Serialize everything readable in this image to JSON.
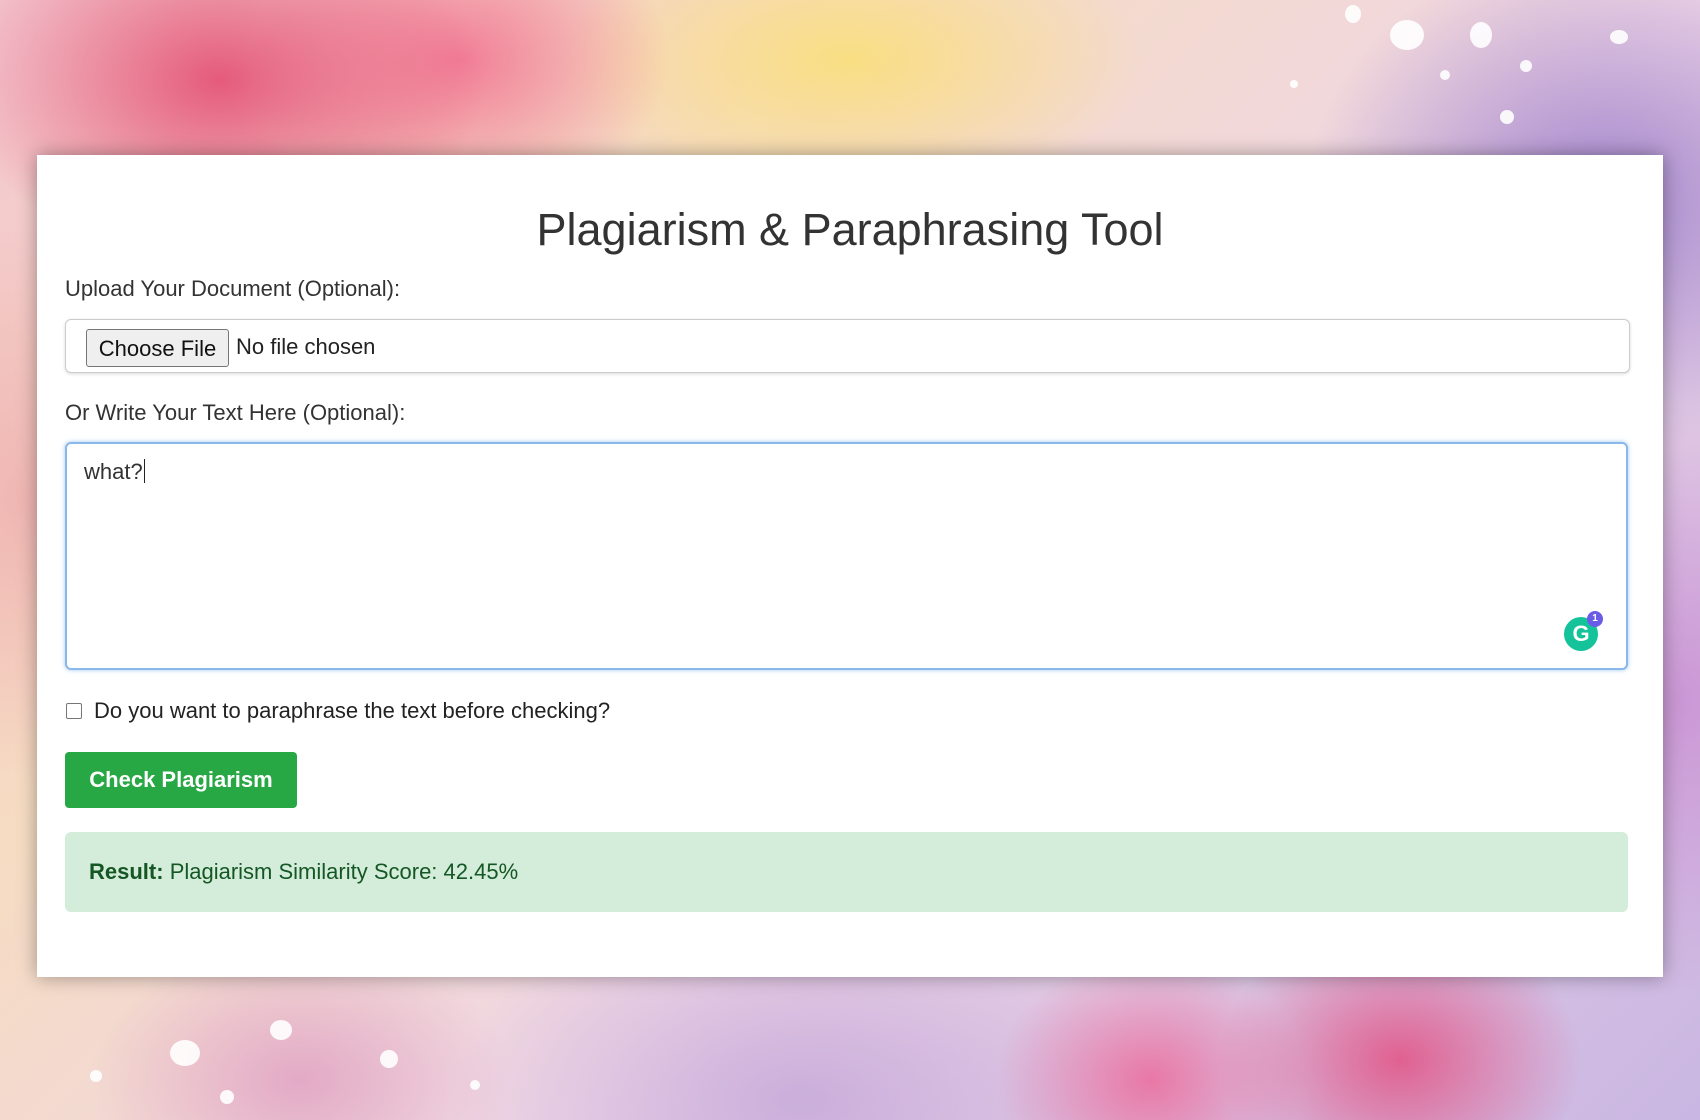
{
  "page": {
    "title": "Plagiarism & Paraphrasing Tool"
  },
  "upload": {
    "label": "Upload Your Document (Optional):",
    "button_label": "Choose File",
    "status": "No file chosen"
  },
  "text_input": {
    "label": "Or Write Your Text Here (Optional):",
    "value": "what?",
    "grammarly_letter": "G",
    "grammarly_count": "1"
  },
  "paraphrase_option": {
    "label": "Do you want to paraphrase the text before checking?",
    "checked": false
  },
  "actions": {
    "check_label": "Check Plagiarism"
  },
  "result": {
    "heading": "Result:",
    "text": "Plagiarism Similarity Score: 42.45%"
  },
  "colors": {
    "primary_button": "#28a745",
    "result_background": "#d4edda",
    "result_text": "#155724",
    "focus_border": "#8ab8ec"
  }
}
